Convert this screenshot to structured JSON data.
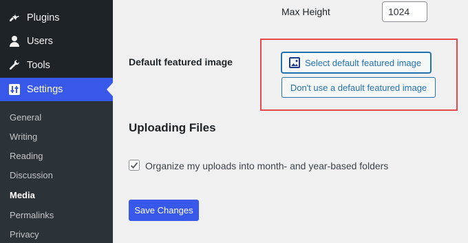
{
  "sidebar": {
    "menu": [
      {
        "label": "Plugins",
        "icon": "plugin-icon"
      },
      {
        "label": "Users",
        "icon": "user-icon"
      },
      {
        "label": "Tools",
        "icon": "wrench-icon"
      },
      {
        "label": "Settings",
        "icon": "settings-sliders-icon",
        "active": true
      }
    ],
    "submenu": [
      {
        "label": "General"
      },
      {
        "label": "Writing"
      },
      {
        "label": "Reading"
      },
      {
        "label": "Discussion"
      },
      {
        "label": "Media",
        "current": true
      },
      {
        "label": "Permalinks"
      },
      {
        "label": "Privacy"
      }
    ]
  },
  "main": {
    "max_height_label": "Max Height",
    "max_height_value": "1024",
    "featured_image": {
      "label": "Default featured image",
      "select_button": "Select default featured image",
      "no_default_button": "Don't use a default featured image"
    },
    "uploading": {
      "title": "Uploading Files",
      "organize_label": "Organize my uploads into month- and year-based folders",
      "organize_checked": true
    },
    "save_button": "Save Changes"
  },
  "colors": {
    "accent": "#3858e9",
    "link": "#2271b1",
    "highlight_border": "#e8484b",
    "sidebar_bg": "#1d2327",
    "submenu_bg": "#2c3338"
  }
}
